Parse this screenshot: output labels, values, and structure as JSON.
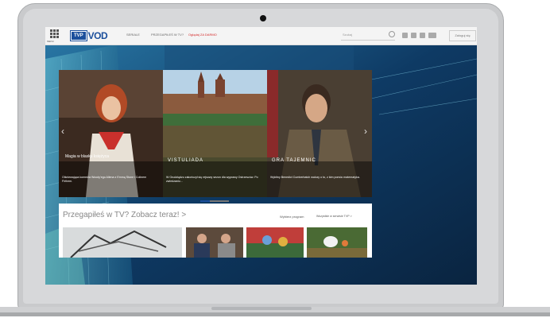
{
  "nav": {
    "menu_label": "MENU",
    "logo_box": "TVP",
    "logo_text": "VOD",
    "items": [
      "SERIALE",
      "PRZEGAPIŁEŚ W TV?",
      "Oglądaj ZA DARMO"
    ],
    "search_placeholder": "Szukaj",
    "login_label": "Zaloguj się"
  },
  "hero": {
    "cards": [
      {
        "title": "Magia w blasku księżyca",
        "desc": "Olśniewająca komedia Woody'ego Allena z Emmą Stone i Colinem Firthem."
      },
      {
        "title": "VISTULIADA",
        "desc": "W Grudziądzu zakończył się rejsowy sezon dla wyprawy Ostrzeszów. Po zwiedzaniu..."
      },
      {
        "title": "GRA TAJEMNIC",
        "desc": "Wybitny Benedict Cumberbatch walczy o to, z kim pomóc matematyka."
      }
    ]
  },
  "lower": {
    "title": "Przegapiłeś w TV? Zobacz teraz! >",
    "link_selected": "Wybierz program",
    "link_all": "Wszystkie w serwisie TVP >"
  },
  "colors": {
    "brand": "#1b4f9c",
    "accent_red": "#d42a2a"
  }
}
